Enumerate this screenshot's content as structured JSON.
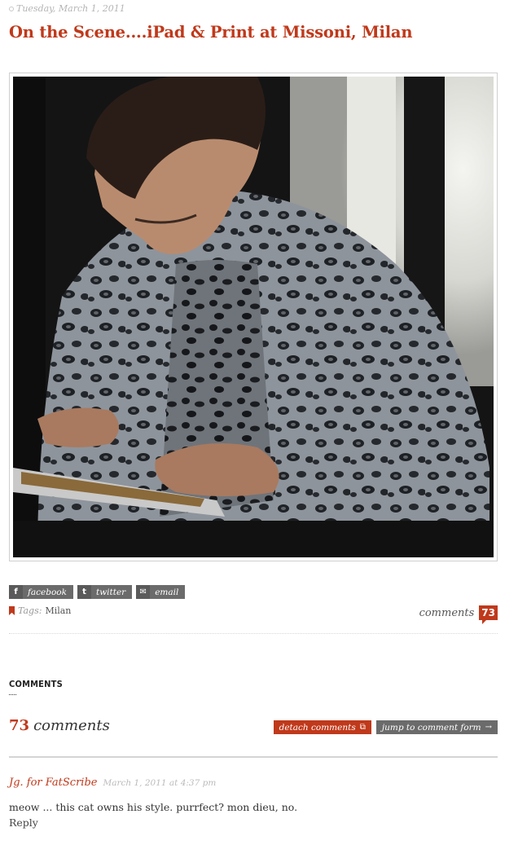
{
  "post": {
    "date": "Tuesday, March 1, 2011",
    "title": "On the Scene....iPad & Print at Missoni, Milan"
  },
  "share": {
    "facebook": {
      "label": "facebook",
      "icon": "facebook-icon"
    },
    "twitter": {
      "label": "twitter",
      "icon": "twitter-icon"
    },
    "email": {
      "label": "email",
      "icon": "email-icon"
    }
  },
  "tags": {
    "label": "Tags:",
    "value": "Milan"
  },
  "comments_link": {
    "label": "comments",
    "count": "73"
  },
  "comments_section": {
    "heading": "COMMENTS",
    "count": "73",
    "count_word": "comments",
    "detach_label": "detach comments",
    "jump_label": "jump to comment form"
  },
  "comments": [
    {
      "author": "Jg. for FatScribe",
      "date": "March 1, 2011 at 4:37 pm",
      "text": "meow ... this cat owns his style. purrfect? mon dieu, no.",
      "reply_label": "Reply"
    }
  ],
  "colors": {
    "accent": "#c0391b",
    "button_gray": "#6b6b6b",
    "muted_text": "#b5b5b5"
  }
}
